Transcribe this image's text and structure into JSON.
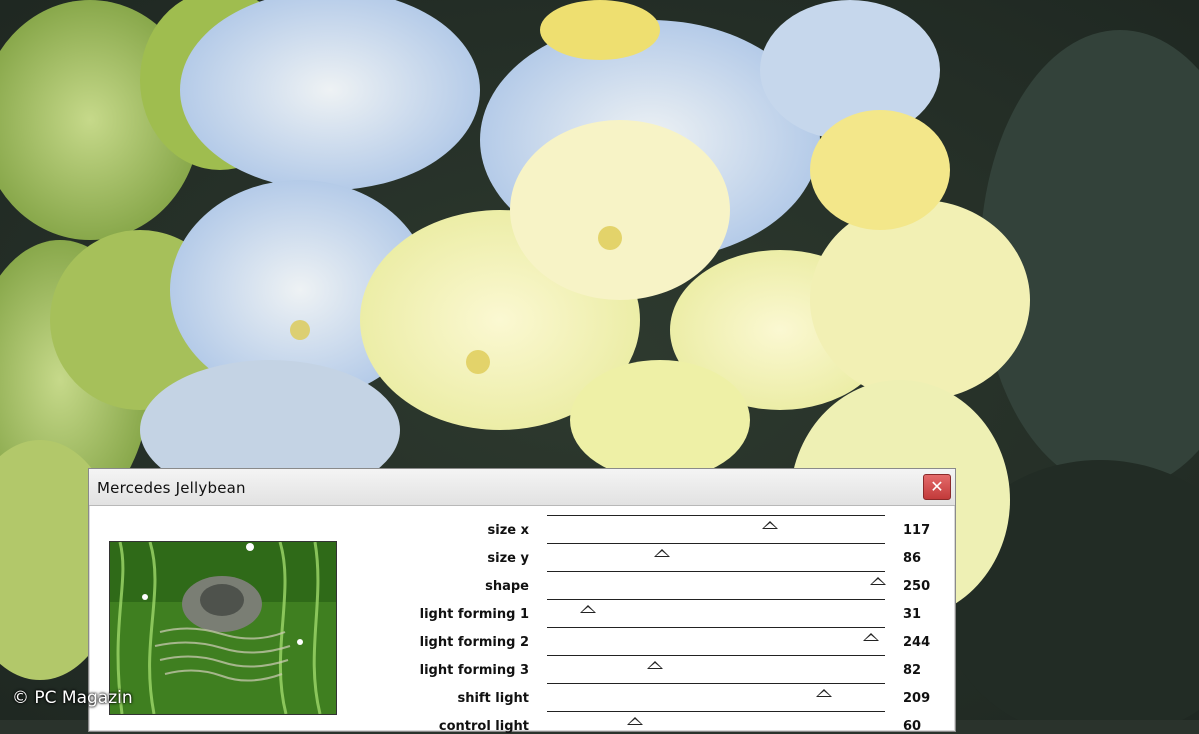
{
  "dialog": {
    "title": "Mercedes Jellybean",
    "close_symbol": "✕",
    "preview_icon": "filter-preview-image",
    "params": [
      {
        "label": "size x",
        "value": "117",
        "level": 0.66
      },
      {
        "label": "size y",
        "value": "86",
        "level": 0.34
      },
      {
        "label": "shape",
        "value": "250",
        "level": 0.98
      },
      {
        "label": "light forming 1",
        "value": "31",
        "level": 0.12
      },
      {
        "label": "light forming 2",
        "value": "244",
        "level": 0.96
      },
      {
        "label": "light forming 3",
        "value": "82",
        "level": 0.32
      },
      {
        "label": "shift light",
        "value": "209",
        "level": 0.82
      },
      {
        "label": "control light",
        "value": "60",
        "level": 0.26
      }
    ]
  },
  "copyright": "© PC Magazin",
  "colors": {
    "background": "#2a332c",
    "petal_yellow": "#f4f2bc",
    "petal_blue": "#bcd0ea",
    "leaf_green": "#8fb04a",
    "close_button": "#d04a4a"
  }
}
